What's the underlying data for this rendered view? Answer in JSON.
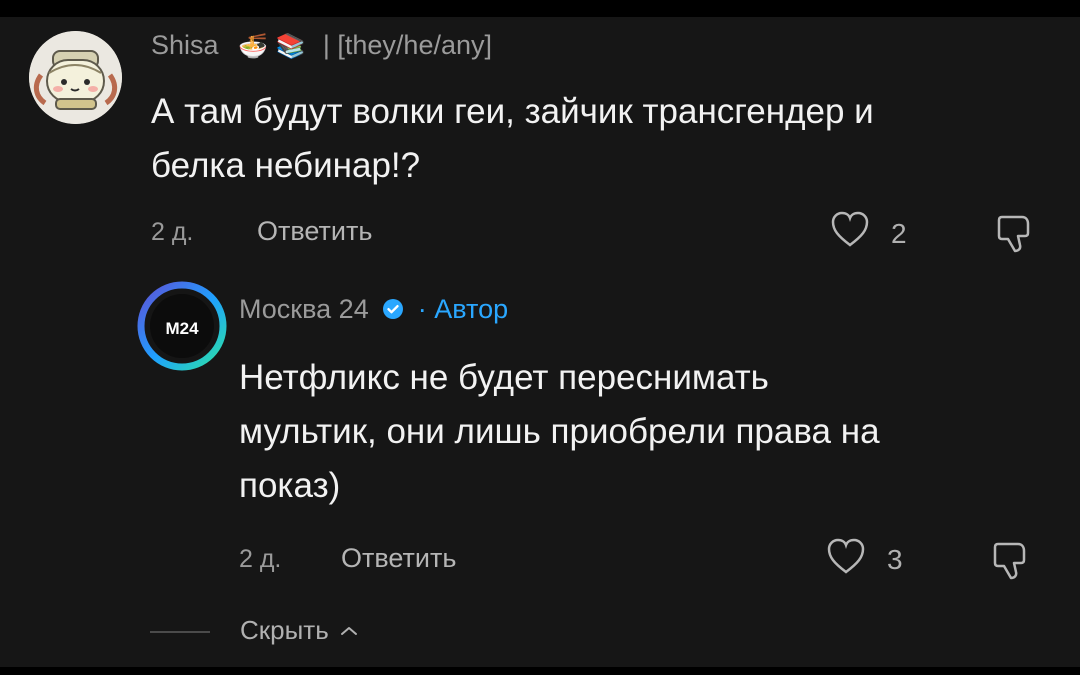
{
  "comments": [
    {
      "author": "Shisa",
      "author_badge": "| [they/he/any]",
      "emoji_1": "🍜",
      "emoji_2": "📚",
      "text_line_1": "А там будут волки геи, зайчик трансгендер и",
      "text_line_2": "белка небинар!?",
      "time": "2 д.",
      "reply_label": "Ответить",
      "likes": "2"
    },
    {
      "author": "Москва 24",
      "author_badge": "· Автор",
      "avatar_label": "M24",
      "text_line_1": "Нетфликс не будет переснимать",
      "text_line_2": "мультик, они лишь приобрели права на",
      "text_line_3": "показ)",
      "time": "2 д.",
      "reply_label": "Ответить",
      "likes": "3"
    }
  ],
  "hide_replies": "Скрыть"
}
